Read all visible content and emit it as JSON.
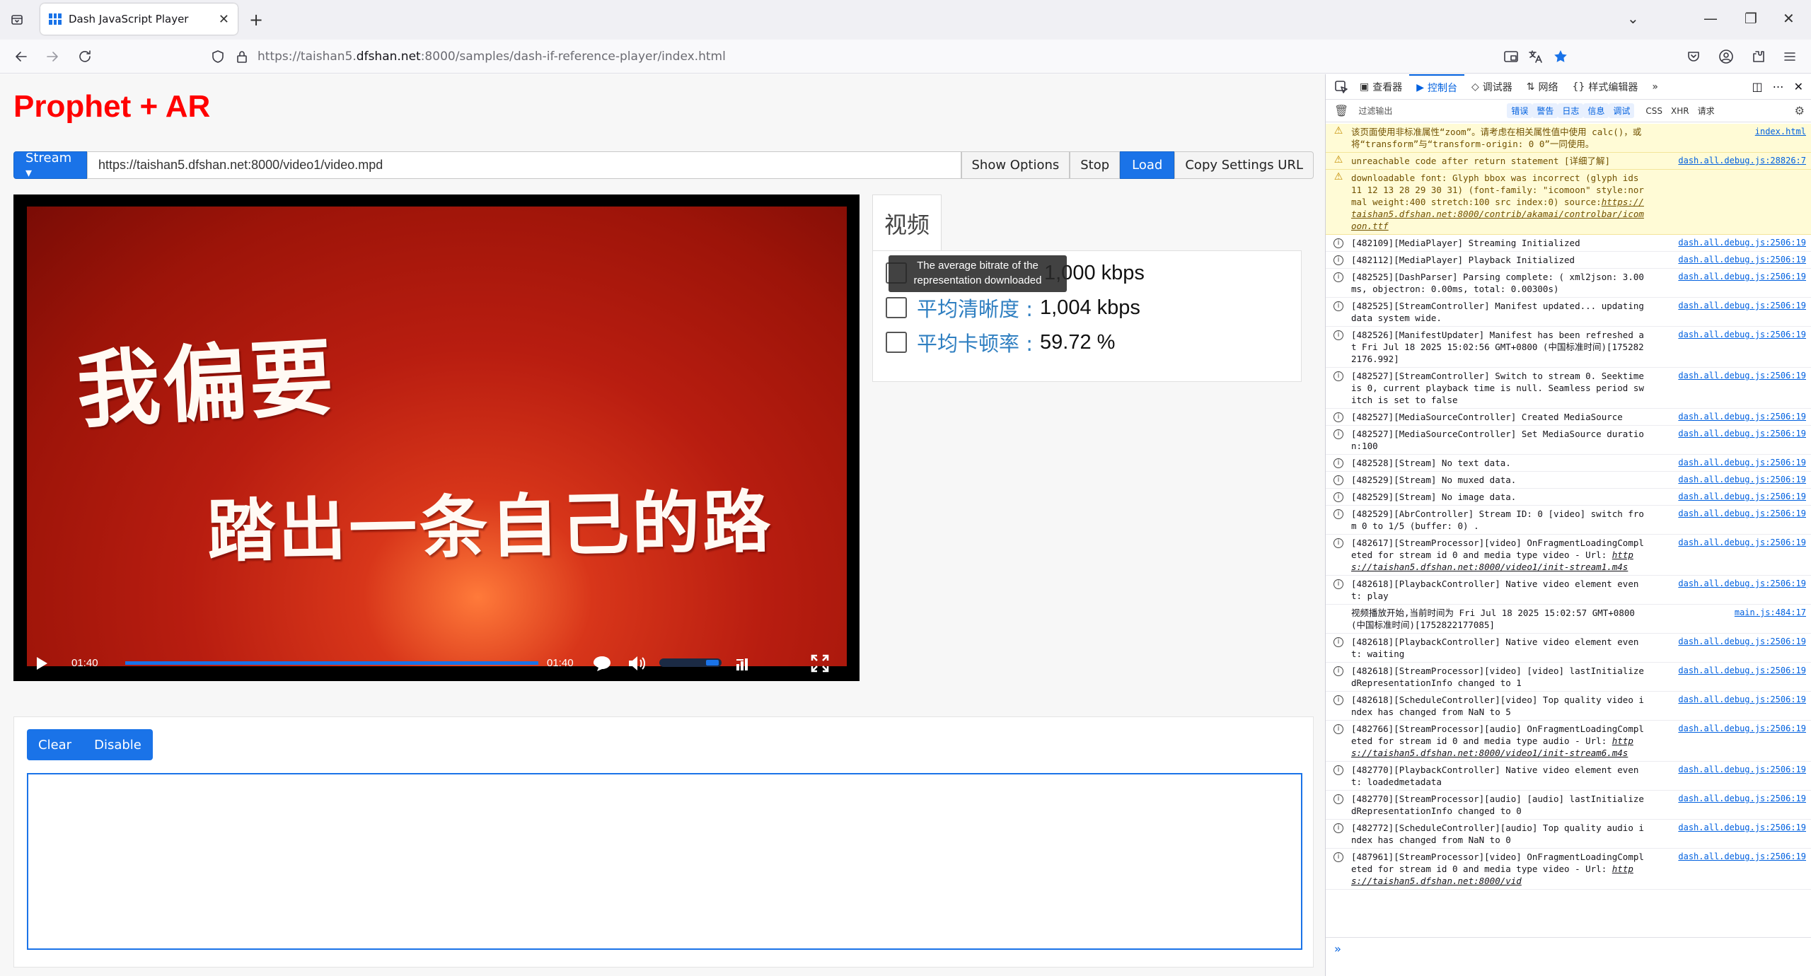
{
  "browser": {
    "tab_title": "Dash JavaScript Player",
    "tab_close": "✕",
    "new_tab": "+",
    "url_prefix": "https://taishan5.",
    "url_domain": "dfshan.net",
    "url_suffix": ":8000/samples/dash-if-reference-player/index.html"
  },
  "page": {
    "title": "Prophet + AR",
    "stream_btn": "Stream ▾",
    "stream_url": "https://taishan5.dfshan.net:8000/video1/video.mpd",
    "show_options": "Show Options",
    "stop": "Stop",
    "load": "Load",
    "copy_settings": "Copy Settings URL"
  },
  "video": {
    "line1": "我偏要",
    "line2": "踏出一条自己的路",
    "time_current": "01:40",
    "time_total": "01:40",
    "progress_fraction": 1.0
  },
  "stats": {
    "tab": "视频",
    "tooltip_line1": "The average bitrate of the",
    "tooltip_line2": "representation downloaded",
    "rows": [
      {
        "label": "",
        "value": "1,000 kbps"
      },
      {
        "label": "平均清晰度 :",
        "value": "1,004 kbps"
      },
      {
        "label": "平均卡顿率 :",
        "value": "59.72 %"
      }
    ]
  },
  "log": {
    "clear": "Clear",
    "disable": "Disable"
  },
  "devtools": {
    "tabs": [
      "查看器",
      "控制台",
      "调试器",
      "网络",
      "样式编辑器"
    ],
    "filter_placeholder": "过滤输出",
    "filters": [
      "错误",
      "警告",
      "日志",
      "信息",
      "调试",
      "CSS",
      "XHR",
      "请求"
    ],
    "messages": [
      {
        "type": "warn",
        "text": "该页面使用非标准属性“zoom”。请考虑在相关属性值中使用 calc()，或将“transform”与“transform-origin: 0 0”一同使用。",
        "src": "index.html"
      },
      {
        "type": "warn",
        "text": "unreachable code after return statement [详细了解]",
        "src": "dash.all.debug.js:28826:7"
      },
      {
        "type": "warn",
        "text": "downloadable font: Glyph bbox was incorrect (glyph ids 11 12 13 28 29 30 31) (font-family: \"icomoon\" style:normal weight:400 stretch:100 src index:0) source:",
        "link": "https://taishan5.dfshan.net:8000/contrib/akamai/controlbar/icomoon.ttf",
        "src": ""
      },
      {
        "type": "info",
        "text": "[482109][MediaPlayer] Streaming Initialized",
        "src": "dash.all.debug.js:2506:19"
      },
      {
        "type": "info",
        "text": "[482112][MediaPlayer] Playback Initialized",
        "src": "dash.all.debug.js:2506:19"
      },
      {
        "type": "info",
        "text": "[482525][DashParser] Parsing complete: ( xml2json: 3.00ms, objectron: 0.00ms, total: 0.00300s)",
        "src": "dash.all.debug.js:2506:19"
      },
      {
        "type": "info",
        "text": "[482525][StreamController] Manifest updated... updating data system wide.",
        "src": "dash.all.debug.js:2506:19"
      },
      {
        "type": "info",
        "text": "[482526][ManifestUpdater] Manifest has been refreshed at Fri Jul 18 2025 15:02:56 GMT+0800 (中国标准时间)[1752822176.992]",
        "src": "dash.all.debug.js:2506:19"
      },
      {
        "type": "info",
        "text": "[482527][StreamController] Switch to stream 0. Seektime is 0, current playback time is null. Seamless period switch is set to false",
        "src": "dash.all.debug.js:2506:19"
      },
      {
        "type": "info",
        "text": "[482527][MediaSourceController] Created MediaSource",
        "src": "dash.all.debug.js:2506:19"
      },
      {
        "type": "info",
        "text": "[482527][MediaSourceController] Set MediaSource duration:100",
        "src": "dash.all.debug.js:2506:19"
      },
      {
        "type": "info",
        "text": "[482528][Stream] No text data.",
        "src": "dash.all.debug.js:2506:19"
      },
      {
        "type": "info",
        "text": "[482529][Stream] No muxed data.",
        "src": "dash.all.debug.js:2506:19"
      },
      {
        "type": "info",
        "text": "[482529][Stream] No image data.",
        "src": "dash.all.debug.js:2506:19"
      },
      {
        "type": "info",
        "text": "[482529][AbrController] Stream ID: 0 [video] switch from 0 to 1/5 (buffer: 0) .",
        "src": "dash.all.debug.js:2506:19"
      },
      {
        "type": "info",
        "text": "[482617][StreamProcessor][video] OnFragmentLoadingCompleted for stream id 0 and media type video - Url: ",
        "link": "https://taishan5.dfshan.net:8000/video1/init-stream1.m4s",
        "src": "dash.all.debug.js:2506:19"
      },
      {
        "type": "info",
        "text": "[482618][PlaybackController] Native video element event: play",
        "src": "dash.all.debug.js:2506:19"
      },
      {
        "type": "plain",
        "text": "视频播放开始,当前时间为 Fri Jul 18 2025 15:02:57 GMT+0800 (中国标准时间)[1752822177085]",
        "src": "main.js:484:17"
      },
      {
        "type": "info",
        "text": "[482618][PlaybackController] Native video element event: waiting",
        "src": "dash.all.debug.js:2506:19"
      },
      {
        "type": "info",
        "text": "[482618][StreamProcessor][video] [video] lastInitializedRepresentationInfo changed to 1",
        "src": "dash.all.debug.js:2506:19"
      },
      {
        "type": "info",
        "text": "[482618][ScheduleController][video] Top quality video index has changed from NaN to 5",
        "src": "dash.all.debug.js:2506:19"
      },
      {
        "type": "info",
        "text": "[482766][StreamProcessor][audio] OnFragmentLoadingCompleted for stream id 0 and media type audio - Url: ",
        "link": "https://taishan5.dfshan.net:8000/video1/init-stream6.m4s",
        "src": "dash.all.debug.js:2506:19"
      },
      {
        "type": "info",
        "text": "[482770][PlaybackController] Native video element event: loadedmetadata",
        "src": "dash.all.debug.js:2506:19"
      },
      {
        "type": "info",
        "text": "[482770][StreamProcessor][audio] [audio] lastInitializedRepresentationInfo changed to 0",
        "src": "dash.all.debug.js:2506:19"
      },
      {
        "type": "info",
        "text": "[482772][ScheduleController][audio] Top quality audio index has changed from NaN to 0",
        "src": "dash.all.debug.js:2506:19"
      },
      {
        "type": "info",
        "text": "[487961][StreamProcessor][video] OnFragmentLoadingCompleted for stream id 0 and media type video - Url: ",
        "link": "https://taishan5.dfshan.net:8000/vid",
        "src": "dash.all.debug.js:2506:19"
      }
    ],
    "prompt": "»"
  }
}
